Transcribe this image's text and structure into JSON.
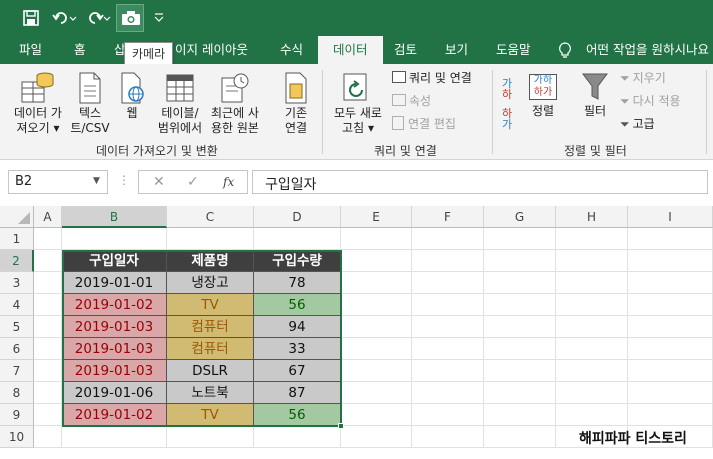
{
  "qat": {
    "tooltip": "카메라"
  },
  "tabs": [
    "파일",
    "홈",
    "삽입",
    "페이지 레이아웃",
    "수식",
    "데이터",
    "검토",
    "보기",
    "도움말"
  ],
  "tab_partial_insert": "삽",
  "tab_partial_layout": "이지 레이아웃",
  "tell_me": "어떤 작업을 원하시나요",
  "ribbon": {
    "get_data_line1": "데이터 가",
    "get_data_line2": "져오기",
    "text_csv_line1": "텍스",
    "text_csv_line2": "트/CSV",
    "web": "웹",
    "table_range_line1": "테이블/",
    "table_range_line2": "범위에서",
    "recent_line1": "최근에 사",
    "recent_line2": "용한 원본",
    "existing_line1": "기존",
    "existing_line2": "연결",
    "group_get_transform": "데이터 가져오기 및 변환",
    "refresh_line1": "모두 새로",
    "refresh_line2": "고침",
    "queries_connections": "쿼리 및 연결",
    "properties": "속성",
    "edit_links": "연결 편집",
    "group_queries": "쿼리 및 연결",
    "sort": "정렬",
    "filter": "필터",
    "clear": "지우기",
    "reapply": "다시 적용",
    "advanced": "고급",
    "group_sort_filter": "정렬 및 필터"
  },
  "formula_bar": {
    "name_box": "B2",
    "fx": "fx",
    "content": "구입일자"
  },
  "columns": [
    "A",
    "B",
    "C",
    "D",
    "E",
    "F",
    "G",
    "H",
    "I"
  ],
  "rows": [
    "1",
    "2",
    "3",
    "4",
    "5",
    "6",
    "7",
    "8",
    "9",
    "10"
  ],
  "table": {
    "headers": [
      "구입일자",
      "제품명",
      "구입수량"
    ],
    "rows": [
      [
        "2019-01-01",
        "냉장고",
        "78"
      ],
      [
        "2019-01-02",
        "TV",
        "56"
      ],
      [
        "2019-01-03",
        "컴퓨터",
        "94"
      ],
      [
        "2019-01-03",
        "컴퓨터",
        "33"
      ],
      [
        "2019-01-03",
        "DSLR",
        "67"
      ],
      [
        "2019-01-06",
        "노트북",
        "87"
      ],
      [
        "2019-01-02",
        "TV",
        "56"
      ]
    ]
  },
  "watermark": "해피파파 티스토리",
  "colors": {
    "excel_green": "#217346",
    "header_bg": "#3f3f3f",
    "gray_cell": "#c9c9c9",
    "red_cell_bg": "#d9a7a7",
    "red_text": "#9c0006",
    "yellow_cell_bg": "#d1bb73",
    "yellow_text": "#9c5700",
    "green_cell_bg": "#a4c9a2",
    "green_text": "#006100"
  }
}
